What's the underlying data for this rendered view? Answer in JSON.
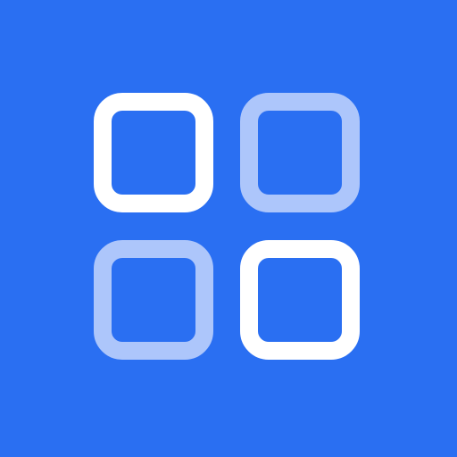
{
  "icon": {
    "name": "grid-view-icon",
    "background_color": "#2a6ff2",
    "tiles": [
      {
        "name": "top-left-square",
        "color": "#ffffff"
      },
      {
        "name": "top-right-square",
        "color": "#adc6fb"
      },
      {
        "name": "bottom-left-square",
        "color": "#adc6fb"
      },
      {
        "name": "bottom-right-square",
        "color": "#ffffff"
      }
    ]
  }
}
